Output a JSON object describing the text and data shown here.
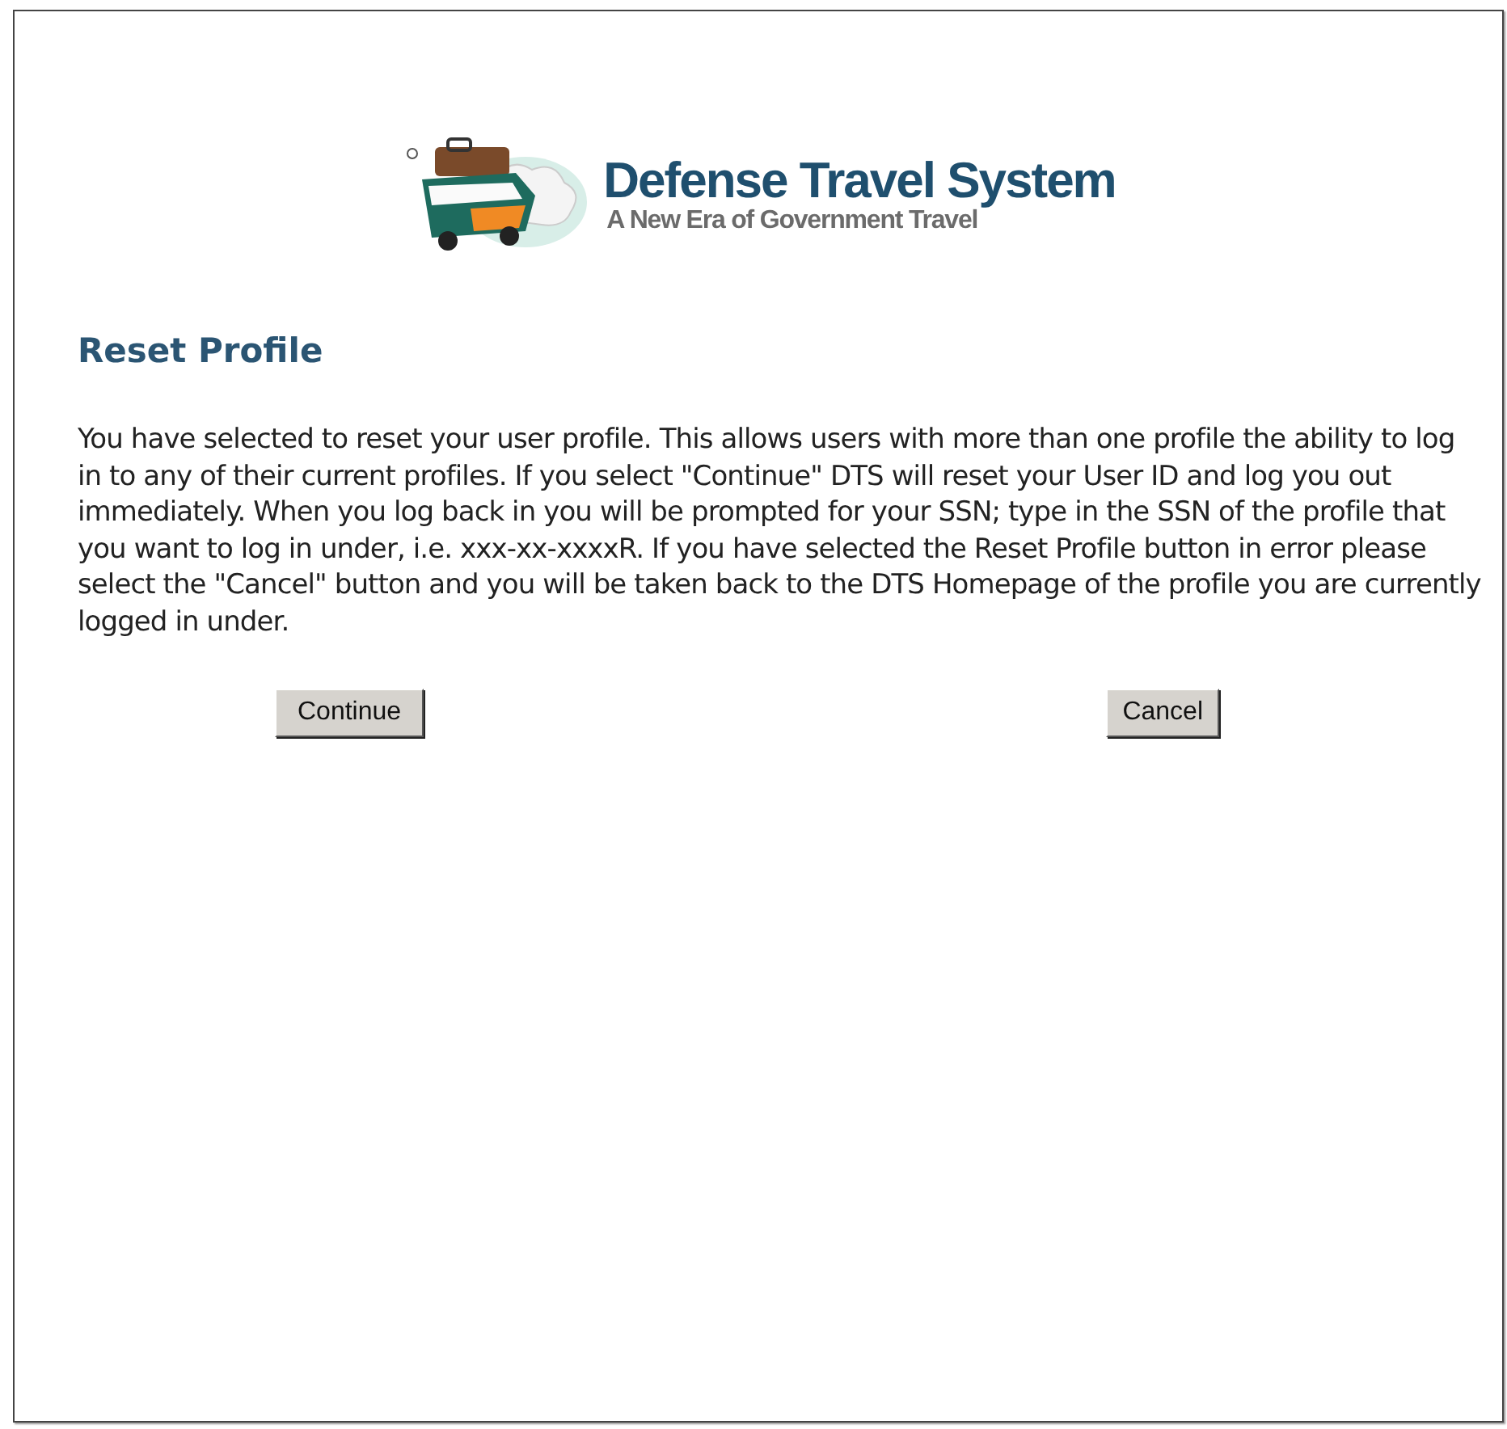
{
  "logo": {
    "title": "Defense Travel System",
    "tagline": "A New Era of Government Travel"
  },
  "heading": "Reset Profile",
  "message": "You have selected to reset your user profile. This allows users with more than one profile the ability to log in to any of their current profiles. If you select \"Continue\" DTS will reset your User ID and log you out immediately. When you log back in you will be prompted for your SSN; type in the SSN of the profile that you want to log in under, i.e. xxx-xx-xxxxR. If you have selected the Reset Profile button in error please select the \"Cancel\" button and you will be taken back to the DTS Homepage of the profile you are currently logged in under.",
  "buttons": [
    "Continue",
    "Cancel"
  ]
}
